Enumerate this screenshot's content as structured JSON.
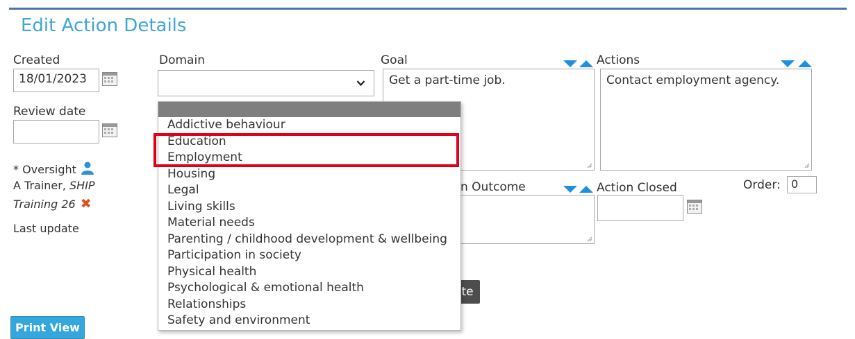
{
  "page": {
    "title": "Edit Action Details"
  },
  "created": {
    "label": "Created",
    "value": "18/01/2023"
  },
  "review": {
    "label": "Review date",
    "value": ""
  },
  "oversight": {
    "label": "* Oversight",
    "trainer_prefix": "A Trainer, ",
    "trainer_org": "SHIP",
    "trainer_org2": "Training 26"
  },
  "last_update": {
    "label": "Last update"
  },
  "domain": {
    "label": "Domain",
    "value": "",
    "options": [
      "Addictive behaviour",
      "Education",
      "Employment",
      "Housing",
      "Legal",
      "Living skills",
      "Material needs",
      "Parenting / childhood development & wellbeing",
      "Participation in society",
      "Physical health",
      "Psychological & emotional health",
      "Relationships",
      "Safety and environment"
    ]
  },
  "goal": {
    "label": "Goal",
    "value": "Get a part-time job."
  },
  "actions": {
    "label": "Actions",
    "value": "Contact employment agency."
  },
  "outcome": {
    "label_partial": "n Outcome",
    "value": ""
  },
  "action_closed": {
    "label": "Action Closed",
    "value": ""
  },
  "order": {
    "label": "Order:",
    "value": "0"
  },
  "buttons": {
    "print_view": "Print View",
    "partial": "te"
  },
  "colors": {
    "accent": "#3ea6d6",
    "highlight": "#e0001a",
    "arrows": "#1e90e0"
  }
}
